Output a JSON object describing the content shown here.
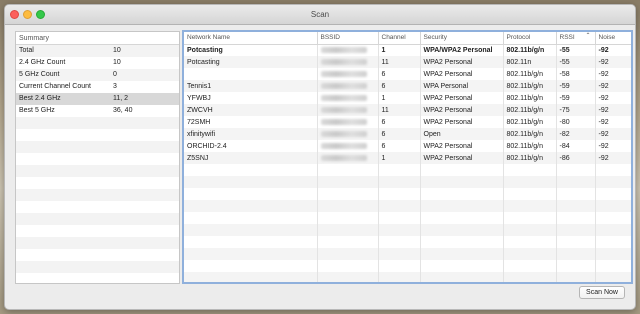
{
  "window": {
    "title": "Scan"
  },
  "summary": {
    "header": "Summary",
    "rows": [
      {
        "label": "Total",
        "value": "10"
      },
      {
        "label": "2.4 GHz Count",
        "value": "10"
      },
      {
        "label": "5 GHz Count",
        "value": "0"
      },
      {
        "label": "Current Channel Count",
        "value": "3"
      },
      {
        "label": "Best 2.4 GHz",
        "value": "11, 2"
      },
      {
        "label": "Best 5 GHz",
        "value": "36, 40"
      }
    ],
    "selected_index": 4
  },
  "table": {
    "columns": [
      "Network Name",
      "BSSID",
      "Channel",
      "Security",
      "Protocol",
      "RSSI",
      "Noise"
    ],
    "sort_column": "RSSI",
    "rows": [
      {
        "network": "Potcasting",
        "channel": "1",
        "security": "WPA/WPA2 Personal",
        "protocol": "802.11b/g/n",
        "rssi": "-55",
        "noise": "-92",
        "bold": true
      },
      {
        "network": "Potcasting",
        "channel": "11",
        "security": "WPA2 Personal",
        "protocol": "802.11n",
        "rssi": "-55",
        "noise": "-92"
      },
      {
        "network": "",
        "channel": "6",
        "security": "WPA2 Personal",
        "protocol": "802.11b/g/n",
        "rssi": "-58",
        "noise": "-92"
      },
      {
        "network": "Tennis1",
        "channel": "6",
        "security": "WPA Personal",
        "protocol": "802.11b/g/n",
        "rssi": "-59",
        "noise": "-92"
      },
      {
        "network": "YFWBJ",
        "channel": "1",
        "security": "WPA2 Personal",
        "protocol": "802.11b/g/n",
        "rssi": "-59",
        "noise": "-92"
      },
      {
        "network": "ZWCVH",
        "channel": "11",
        "security": "WPA2 Personal",
        "protocol": "802.11b/g/n",
        "rssi": "-75",
        "noise": "-92"
      },
      {
        "network": "72SMH",
        "channel": "6",
        "security": "WPA2 Personal",
        "protocol": "802.11b/g/n",
        "rssi": "-80",
        "noise": "-92"
      },
      {
        "network": "xfinitywifi",
        "channel": "6",
        "security": "Open",
        "protocol": "802.11b/g/n",
        "rssi": "-82",
        "noise": "-92"
      },
      {
        "network": "ORCHID-2.4",
        "channel": "6",
        "security": "WPA2 Personal",
        "protocol": "802.11b/g/n",
        "rssi": "-84",
        "noise": "-92"
      },
      {
        "network": "Z5SNJ",
        "channel": "1",
        "security": "WPA2 Personal",
        "protocol": "802.11b/g/n",
        "rssi": "-86",
        "noise": "-92"
      }
    ],
    "empty_rows": 10
  },
  "footer": {
    "scan_button": "Scan Now"
  }
}
